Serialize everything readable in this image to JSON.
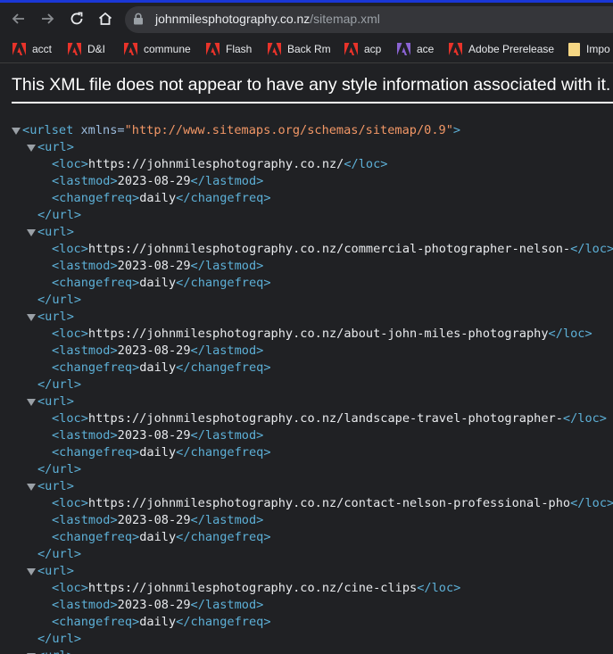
{
  "browser": {
    "url_host": "johnmilesphotography.co.nz",
    "url_path": "/sitemap.xml",
    "bookmarks": [
      {
        "label": "acct",
        "icon": "adobe-icon"
      },
      {
        "label": "D&I",
        "icon": "adobe-icon"
      },
      {
        "label": "commune",
        "icon": "adobe-icon"
      },
      {
        "label": "Flash",
        "icon": "adobe-icon"
      },
      {
        "label": "Back Rm",
        "icon": "adobe-icon"
      },
      {
        "label": "acp",
        "icon": "adobe-icon"
      },
      {
        "label": "ace",
        "icon": "purple-adobe-icon"
      },
      {
        "label": "Adobe Prerelease",
        "icon": "adobe-icon"
      },
      {
        "label": "Impo",
        "icon": "folder-icon"
      }
    ]
  },
  "page": {
    "header": "This XML file does not appear to have any style information associated with it. The document tree is shown below.",
    "urlset_tag": "urlset",
    "xmlns_attr": "xmlns",
    "xmlns_value": "\"http://www.sitemaps.org/schemas/sitemap/0.9\"",
    "url_tag": "url",
    "loc_tag": "loc",
    "lastmod_tag": "lastmod",
    "changefreq_tag": "changefreq",
    "entries": [
      {
        "loc": "https://johnmilesphotography.co.nz/",
        "lastmod": "2023-08-29",
        "changefreq": "daily"
      },
      {
        "loc": "https://johnmilesphotography.co.nz/commercial-photographer-nelson-",
        "lastmod": "2023-08-29",
        "changefreq": "daily"
      },
      {
        "loc": "https://johnmilesphotography.co.nz/about-john-miles-photography",
        "lastmod": "2023-08-29",
        "changefreq": "daily"
      },
      {
        "loc": "https://johnmilesphotography.co.nz/landscape-travel-photographer-",
        "lastmod": "2023-08-29",
        "changefreq": "daily"
      },
      {
        "loc": "https://johnmilesphotography.co.nz/contact-nelson-professional-pho",
        "lastmod": "2023-08-29",
        "changefreq": "daily"
      },
      {
        "loc": "https://johnmilesphotography.co.nz/cine-clips",
        "lastmod": "2023-08-29",
        "changefreq": "daily"
      }
    ]
  }
}
